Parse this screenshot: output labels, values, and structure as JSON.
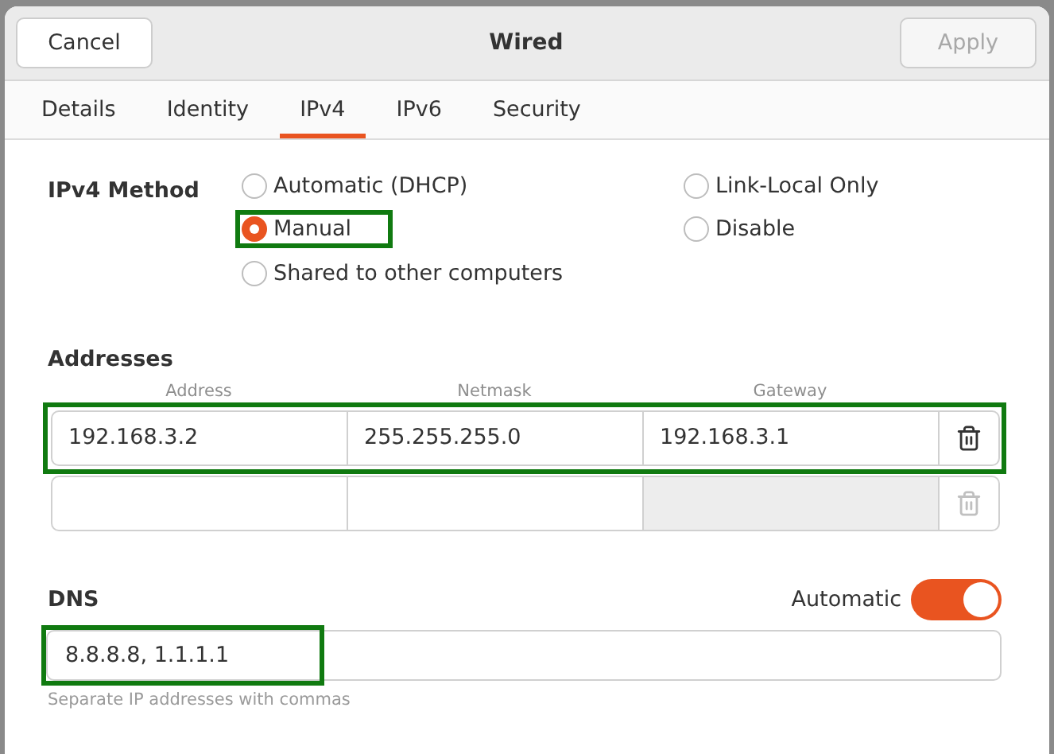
{
  "header": {
    "title": "Wired",
    "cancel": "Cancel",
    "apply": {
      "label": "Apply",
      "disabled": true
    }
  },
  "tabs": [
    {
      "label": "Details",
      "selected": false
    },
    {
      "label": "Identity",
      "selected": false
    },
    {
      "label": "IPv4",
      "selected": true
    },
    {
      "label": "IPv6",
      "selected": false
    },
    {
      "label": "Security",
      "selected": false
    }
  ],
  "method": {
    "label": "IPv4 Method",
    "options": [
      {
        "label": "Automatic (DHCP)",
        "selected": false,
        "highlighted": false
      },
      {
        "label": "Manual",
        "selected": true,
        "highlighted": true
      },
      {
        "label": "Shared to other computers",
        "selected": false,
        "highlighted": false
      },
      {
        "label": "Link-Local Only",
        "selected": false,
        "highlighted": false
      },
      {
        "label": "Disable",
        "selected": false,
        "highlighted": false
      }
    ]
  },
  "addresses": {
    "label": "Addresses",
    "columns": [
      "Address",
      "Netmask",
      "Gateway"
    ],
    "rows": [
      {
        "address": "192.168.3.2",
        "netmask": "255.255.255.0",
        "gateway": "192.168.3.1",
        "gateway_disabled": false,
        "delete_disabled": false,
        "highlighted": true
      },
      {
        "gateway_disabled": true,
        "delete_disabled": true,
        "highlighted": false
      }
    ]
  },
  "dns": {
    "label": "DNS",
    "automatic_label": "Automatic",
    "automatic": true,
    "value": "8.8.8.8, 1.1.1.1",
    "highlighted": true,
    "hint": "Separate IP addresses with commas"
  }
}
